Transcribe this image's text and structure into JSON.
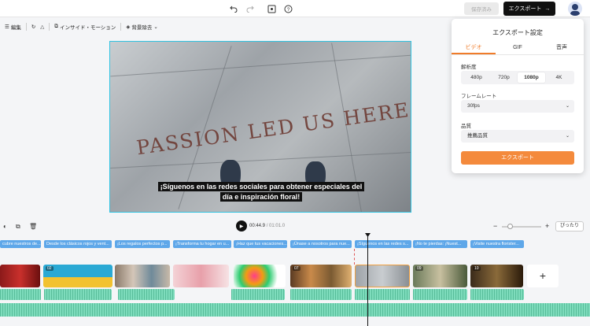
{
  "topbar": {
    "save_label": "保存済み",
    "export_label": "エクスポート",
    "export_arrow": "→"
  },
  "toolbar": {
    "edit_label": "編集",
    "insight_label": "インサイド・モーション",
    "bg_remove_label": "背景除去"
  },
  "preview": {
    "headline": "PASSION LED US HERE",
    "subtitle_line1": "¡Síguenos en las redes sociales para obtener especiales del",
    "subtitle_line2": "día e inspiración floral!"
  },
  "export_panel": {
    "title": "エクスポート設定",
    "tabs": [
      "ビデオ",
      "GIF",
      "音声"
    ],
    "active_tab": "ビデオ",
    "resolution_label": "解析度",
    "resolutions": [
      "480p",
      "720p",
      "1080p",
      "4K"
    ],
    "selected_resolution": "1080p",
    "framerate_label": "フレームレート",
    "framerate_value": "30fps",
    "quality_label": "品質",
    "quality_value": "推薦品質",
    "export_button": "エクスポート"
  },
  "timeline": {
    "current_time": "00:44.9",
    "total_time": "/ 01:01.0",
    "fit_label": "ぴったり",
    "text_tracks": [
      "cubre nuestros de...",
      "Desde los clásicos rojos y vent...",
      "¡Los regalos perfectos p...",
      "¡Transforma tu hogar en u...",
      "¡Haz que tus vacaciones...",
      "¡Únase a nosotros para nue...",
      "¡Síguenos en las redes s...",
      "¡No te pierdas: ¡Nuest...",
      "¡Visite nuestra florister..."
    ],
    "clip_badges": [
      "",
      "02",
      "",
      "",
      "",
      "07",
      "",
      "09",
      "10"
    ],
    "add_clip_label": "+"
  },
  "colors": {
    "accent": "#f07c2a",
    "preview_border": "#32c2e0",
    "text_track": "#5ea7e9",
    "audio_track": "#7edcbc"
  }
}
